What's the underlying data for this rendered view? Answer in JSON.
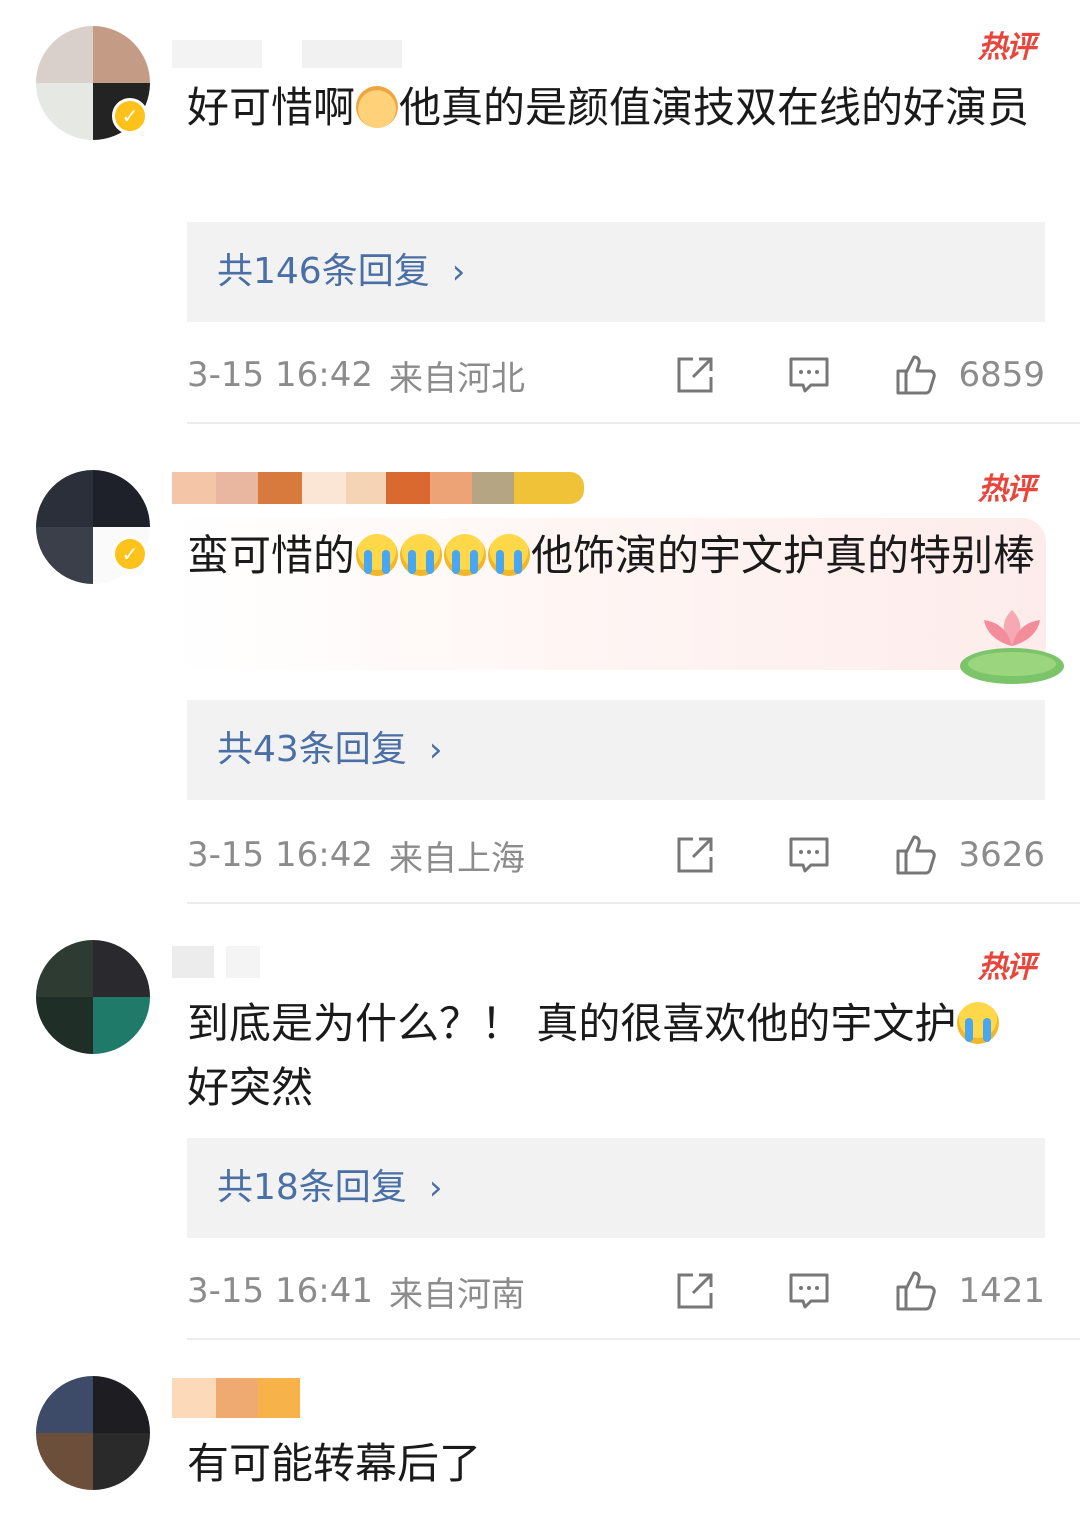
{
  "comments": [
    {
      "hot_label": "热评",
      "text_before": "好可惜啊",
      "text_after": "他真的是颜值演技双在线的好演员",
      "replies": "共146条回复",
      "chevron": "›",
      "time": "3-15 16:42",
      "location": "来自河北",
      "likes": "6859",
      "verified": true
    },
    {
      "hot_label": "热评",
      "text_before": "蛮可惜的",
      "text_after": "他饰演的宇文护真的特别棒",
      "replies": "共43条回复",
      "chevron": "›",
      "time": "3-15 16:42",
      "location": "来自上海",
      "likes": "3626",
      "verified": true
    },
    {
      "hot_label": "热评",
      "text_before": "到底是为什么？！ 真的很喜欢他的宇文护",
      "text_after": "好突然",
      "replies": "共18条回复",
      "chevron": "›",
      "time": "3-15 16:41",
      "location": "来自河南",
      "likes": "1421",
      "verified": false
    },
    {
      "text_before": "有可能转幕后了",
      "verified": false
    }
  ],
  "icons": {
    "share": "share-icon",
    "comment": "comment-icon",
    "like": "thumbs-up-icon",
    "emoji_cat": "sad-cat-emoji-icon",
    "emoji_cry": "crying-face-emoji-icon",
    "verified": "verified-badge-icon",
    "lotus": "lotus-decoration-icon"
  },
  "colors": {
    "hot": "#e8463c",
    "reply_link": "#4a6fa5",
    "meta_text": "#8c8c8c",
    "verified_badge": "#ffc21a"
  }
}
